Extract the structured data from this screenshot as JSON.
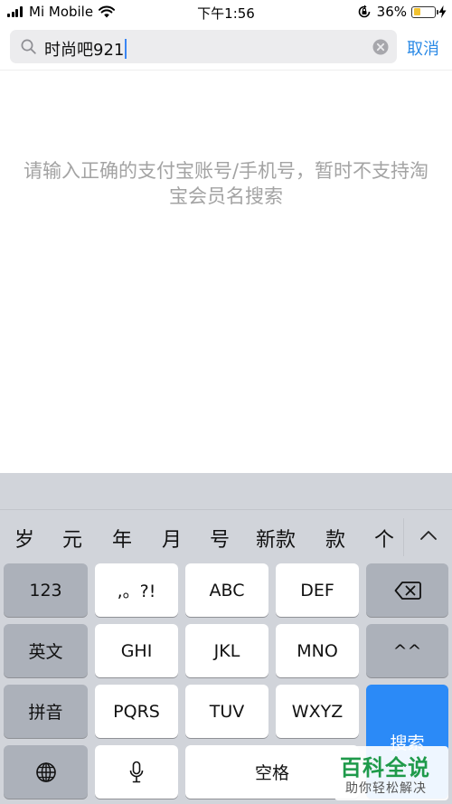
{
  "status_bar": {
    "carrier": "Mi Mobile",
    "time": "下午1:56",
    "battery_percent": "36%",
    "battery_level": 0.36,
    "icons": [
      "signal-icon",
      "wifi-icon",
      "rotation-lock-icon",
      "battery-icon",
      "charging-icon"
    ]
  },
  "search": {
    "value": "时尚吧921",
    "cancel_label": "取消"
  },
  "hint": {
    "text": "请输入正确的支付宝账号/手机号，暂时不支持淘宝会员名搜索"
  },
  "keyboard": {
    "candidates": [
      "岁",
      "元",
      "年",
      "月",
      "号",
      "新款",
      "款",
      "个"
    ],
    "rows": {
      "r1": {
        "k1": "123",
        "k2": ",。?!",
        "k3": "ABC",
        "k4": "DEF"
      },
      "r2": {
        "k1": "英文",
        "k2": "GHI",
        "k3": "JKL",
        "k4": "MNO",
        "k5": "^^"
      },
      "r3": {
        "k1": "拼音",
        "k2": "PQRS",
        "k3": "TUV",
        "k4": "WXYZ",
        "k5": "搜索"
      },
      "r4": {
        "k3": "空格"
      }
    }
  },
  "watermark": {
    "title": "百科全说",
    "subtitle": "助你轻松解决"
  },
  "colors": {
    "accent": "#2b8ae6",
    "search_key": "#2b8af7",
    "keyboard_bg": "#d1d4da",
    "hint_text": "#a3a3a3"
  }
}
